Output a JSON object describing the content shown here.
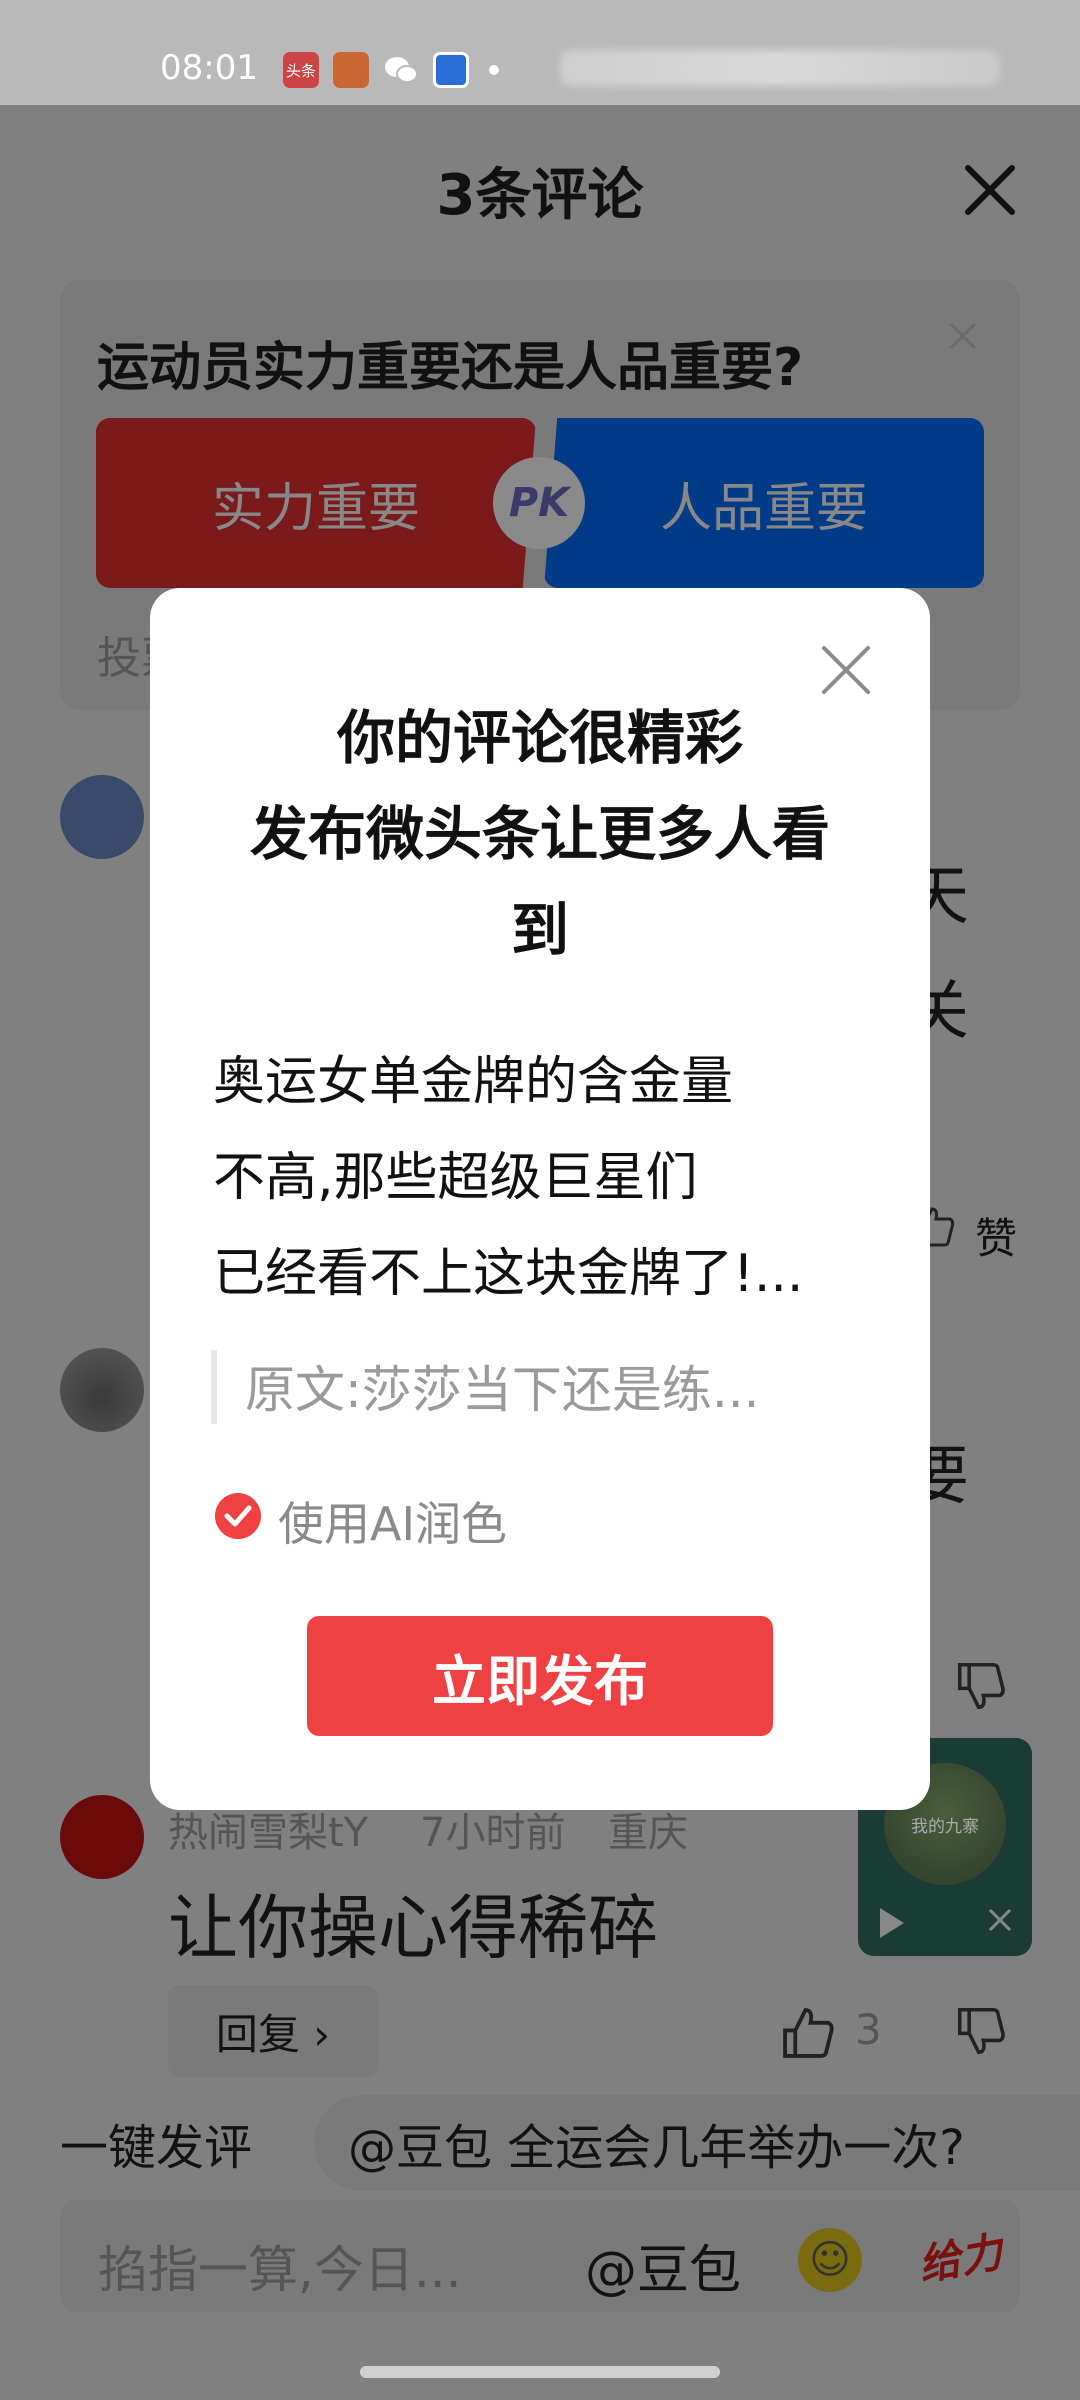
{
  "status_bar": {
    "time": "08:01",
    "app_icons": [
      "头条",
      "toutiao-alt-icon",
      "wechat-icon",
      "browser-icon"
    ]
  },
  "sheet": {
    "title": "3条评论"
  },
  "poll": {
    "question": "运动员实力重要还是人品重要?",
    "option_left": "实力重要",
    "option_right": "人品重要",
    "pk_label": "PK",
    "footer_partial": "投票"
  },
  "background_comments": {
    "c1_right_glyphs": [
      "天",
      "关"
    ],
    "like_label": "赞",
    "c2_right_glyph": "要",
    "c3": {
      "author": "热闹雪梨tY",
      "time": "7小时前",
      "location": "重庆",
      "text": "让你操心得稀碎",
      "likes": "3"
    }
  },
  "reply_button": "回复 ›",
  "float_player": {
    "title": "我的九寨"
  },
  "quick_comment": {
    "label": "一键发评",
    "suggestion": "@豆包 全运会几年举办一次?"
  },
  "input_bar": {
    "placeholder": "掐指一算,今日...",
    "mention": "@豆包",
    "gift_text": "给力"
  },
  "modal": {
    "title_lines": [
      "你的评论很精彩",
      "发布微头条让更多人看",
      "到"
    ],
    "body_lines": [
      "奥运女单金牌的含金量",
      "不高,那些超级巨星们",
      "已经看不上这块金牌了!..."
    ],
    "original_text": "原文:莎莎当下还是练...",
    "ai_polish_label": "使用AI润色",
    "ai_polish_checked": true,
    "publish_label": "立即发布"
  },
  "colors": {
    "accent_red": "#f04142",
    "poll_red": "#c42a2a",
    "poll_blue": "#0760d8"
  }
}
